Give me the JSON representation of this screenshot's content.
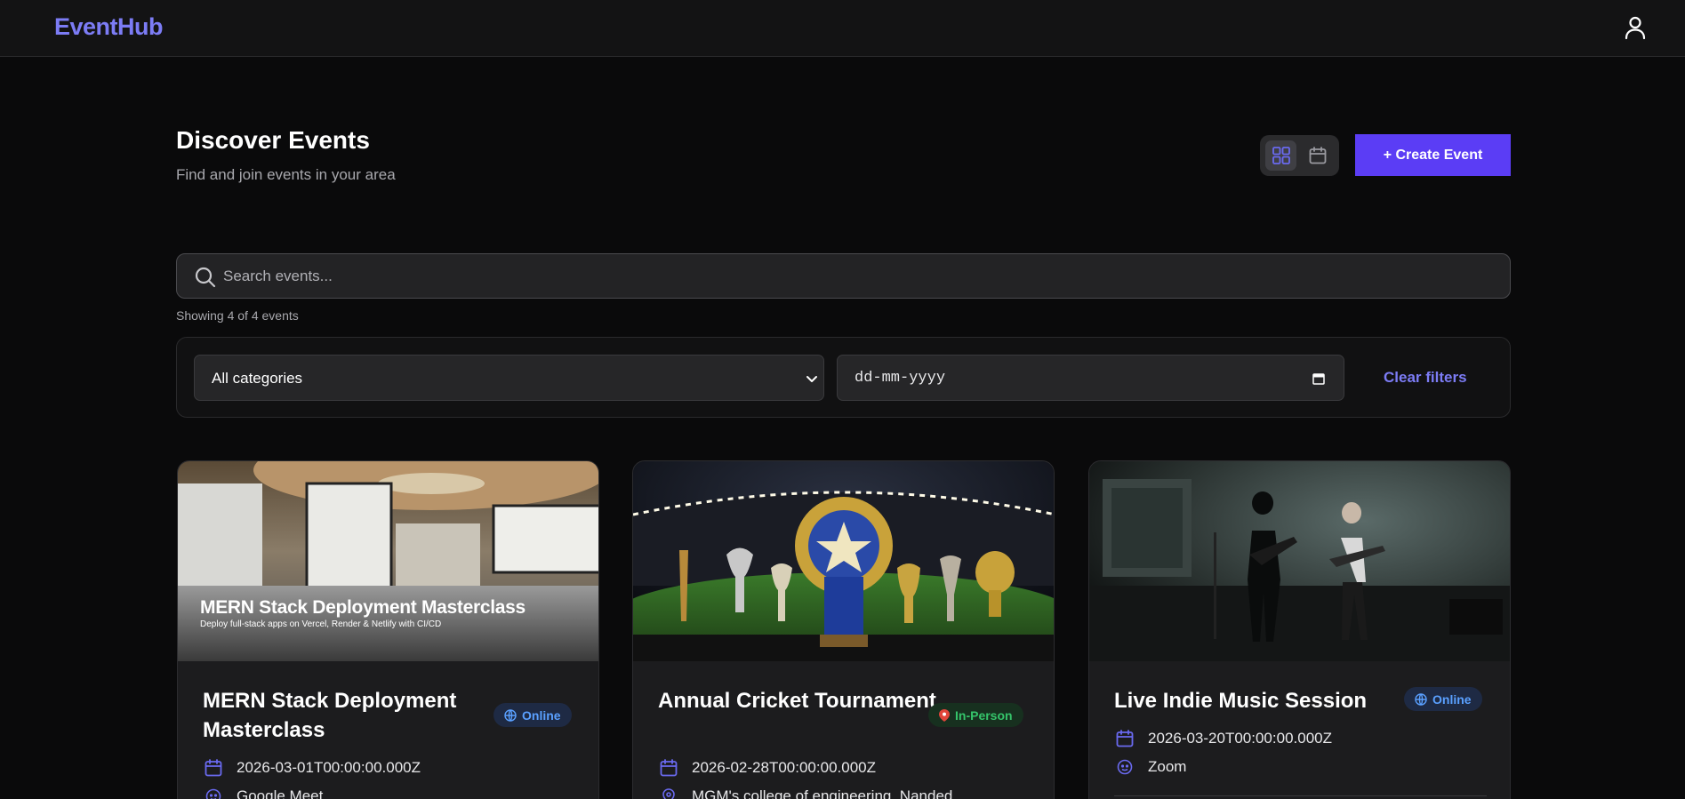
{
  "app": {
    "logo": "EventHub"
  },
  "header": {
    "title": "Discover Events",
    "subtitle": "Find and join events in your area",
    "create_label": "+ Create Event"
  },
  "search": {
    "placeholder": "Search events..."
  },
  "results": {
    "showing": "Showing 4 of 4 events"
  },
  "filters": {
    "category": "All categories",
    "date_placeholder": "dd-mm-yyyy",
    "clear_label": "Clear filters"
  },
  "colors": {
    "accent": "#5b3df5",
    "brand": "#7c7cf5",
    "online": "#5aa0ff",
    "inperson": "#35c46a"
  },
  "events": [
    {
      "title": "MERN Stack Deployment Masterclass",
      "badge": "Online",
      "badge_type": "online",
      "date": "2026-03-01T00:00:00.000Z",
      "location": "Google Meet",
      "location_icon": "meet-icon",
      "image_title": "MERN Stack Deployment Masterclass",
      "image_subtitle": "Deploy full-stack apps on Vercel, Render & Netlify with CI/CD"
    },
    {
      "title": "Annual Cricket Tournament",
      "badge": "In-Person",
      "badge_type": "inperson",
      "date": "2026-02-28T00:00:00.000Z",
      "location": "MGM's college of engineering, Nanded",
      "location_icon": "map-pin-icon"
    },
    {
      "title": "Live Indie Music Session",
      "badge": "Online",
      "badge_type": "online",
      "date": "2026-03-20T00:00:00.000Z",
      "location": "Zoom",
      "location_icon": "meet-icon"
    }
  ]
}
